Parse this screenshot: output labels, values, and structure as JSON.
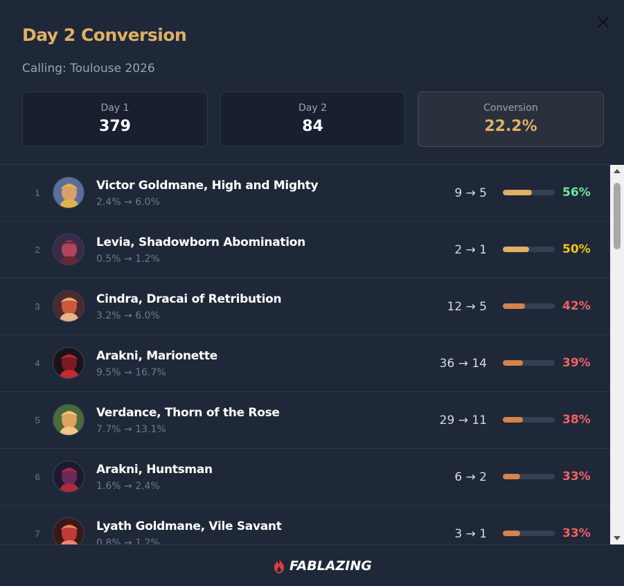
{
  "dialog": {
    "title": "Day 2 Conversion",
    "subtitle": "Calling: Toulouse 2026"
  },
  "stats": [
    {
      "label": "Day 1",
      "value": "379"
    },
    {
      "label": "Day 2",
      "value": "84"
    },
    {
      "label": "Conversion",
      "value": "22.2%"
    }
  ],
  "rows": [
    {
      "rank": "1",
      "name": "Victor Goldmane, High and Mighty",
      "share": "2.4% → 6.0%",
      "counts": "9 → 5",
      "pct": "56%",
      "fraction": 0.56,
      "bar_color": "#e0b066",
      "pct_color": "#6ee7a0"
    },
    {
      "rank": "2",
      "name": "Levia, Shadowborn Abomination",
      "share": "0.5% → 1.2%",
      "counts": "2 → 1",
      "pct": "50%",
      "fraction": 0.5,
      "bar_color": "#e0b066",
      "pct_color": "#f5c518"
    },
    {
      "rank": "3",
      "name": "Cindra, Dracai of Retribution",
      "share": "3.2% → 6.0%",
      "counts": "12 → 5",
      "pct": "42%",
      "fraction": 0.42,
      "bar_color": "#d4834a",
      "pct_color": "#f06262"
    },
    {
      "rank": "4",
      "name": "Arakni, Marionette",
      "share": "9.5% → 16.7%",
      "counts": "36 → 14",
      "pct": "39%",
      "fraction": 0.39,
      "bar_color": "#d4834a",
      "pct_color": "#f06262"
    },
    {
      "rank": "5",
      "name": "Verdance, Thorn of the Rose",
      "share": "7.7% → 13.1%",
      "counts": "29 → 11",
      "pct": "38%",
      "fraction": 0.38,
      "bar_color": "#d4834a",
      "pct_color": "#f06262"
    },
    {
      "rank": "6",
      "name": "Arakni, Huntsman",
      "share": "1.6% → 2.4%",
      "counts": "6 → 2",
      "pct": "33%",
      "fraction": 0.33,
      "bar_color": "#d4834a",
      "pct_color": "#f06262"
    },
    {
      "rank": "7",
      "name": "Lyath Goldmane, Vile Savant",
      "share": "0.8% → 1.2%",
      "counts": "3 → 1",
      "pct": "33%",
      "fraction": 0.33,
      "bar_color": "#d4834a",
      "pct_color": "#f06262"
    }
  ],
  "footer": {
    "brand": "FABLAZING",
    "logo_icon": "flame-logo-icon"
  },
  "colors": {
    "accent": "#e0b066",
    "background": "#1f2838"
  }
}
